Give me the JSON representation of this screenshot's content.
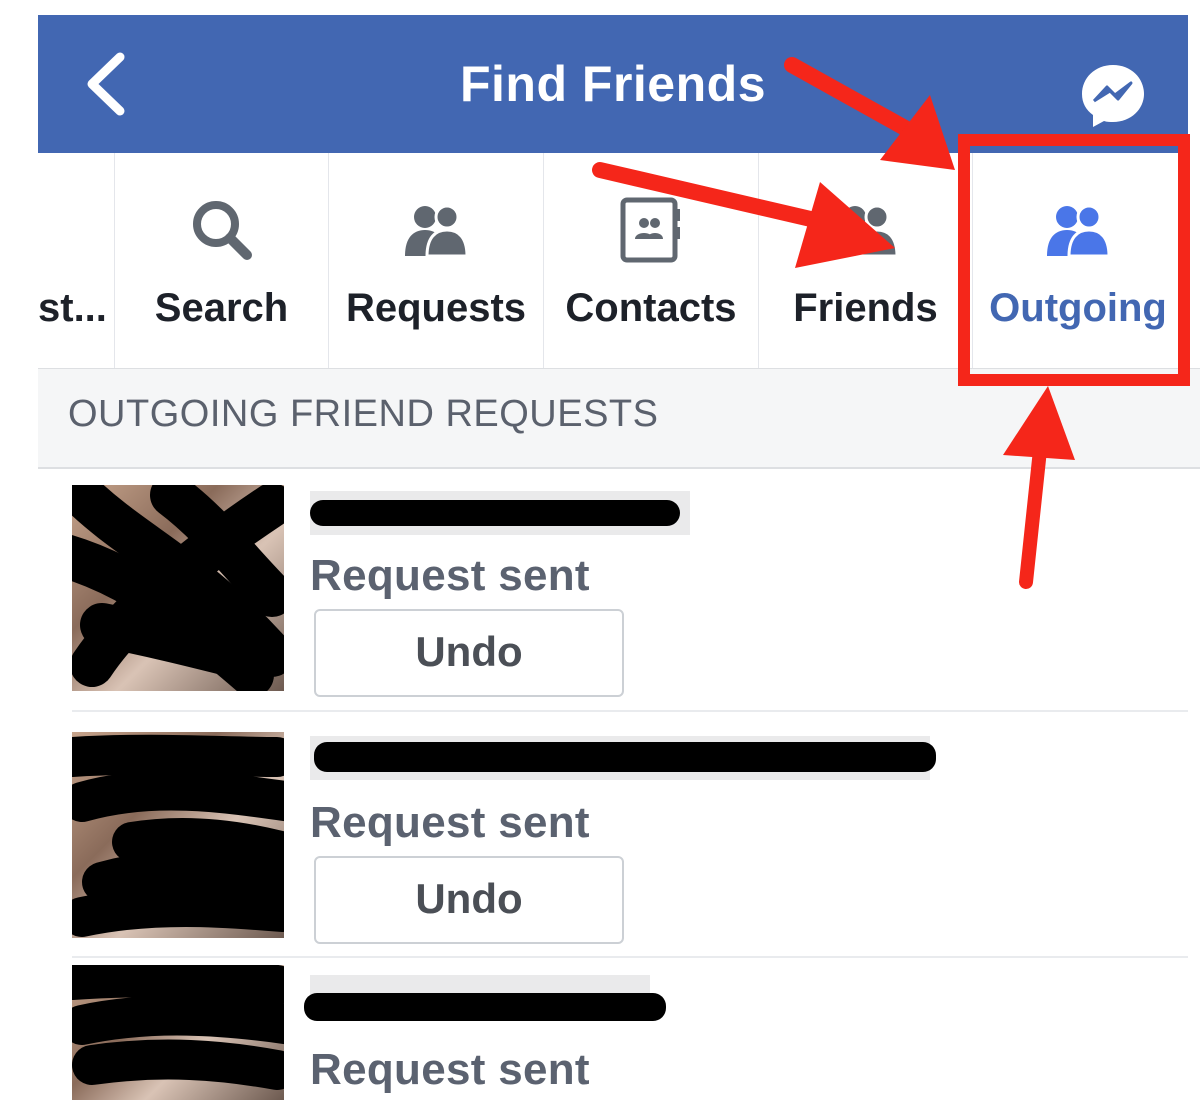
{
  "header": {
    "title": "Find Friends",
    "back_icon": "chevron-left-icon",
    "messenger_icon": "messenger-icon",
    "background": "#4267b2"
  },
  "tabs": [
    {
      "label": "st...",
      "icon": "none",
      "active": false
    },
    {
      "label": "Search",
      "icon": "search-icon",
      "active": false
    },
    {
      "label": "Requests",
      "icon": "people-icon",
      "active": false
    },
    {
      "label": "Contacts",
      "icon": "contacts-book-icon",
      "active": false
    },
    {
      "label": "Friends",
      "icon": "people-icon",
      "active": false
    },
    {
      "label": "Outgoing",
      "icon": "people-icon",
      "active": true
    }
  ],
  "section": {
    "title": "OUTGOING FRIEND REQUESTS"
  },
  "requests": [
    {
      "status": "Request sent",
      "undo_label": "Undo"
    },
    {
      "status": "Request sent",
      "undo_label": "Undo"
    },
    {
      "status": "Request sent"
    }
  ],
  "annotation": {
    "color": "#f5261a",
    "highlight_box": "red-highlight-box"
  }
}
